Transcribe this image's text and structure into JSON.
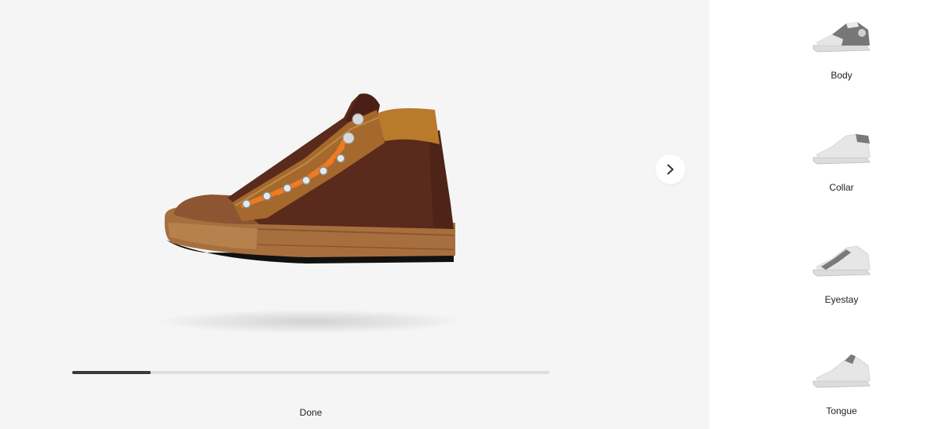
{
  "product": {
    "preview_image": "customized-high-top-sneaker",
    "colors": {
      "upper": "#5a2a1c",
      "collar": "#b97a2c",
      "sole": "#a86f3e",
      "laces": "#f07a22",
      "outsole": "#111111"
    }
  },
  "navigation": {
    "next_icon": "chevron-right-icon"
  },
  "progress": {
    "value": 0.165
  },
  "actions": {
    "done_label": "Done"
  },
  "parts": [
    {
      "label": "Body",
      "icon": "sneaker-body-thumbnail"
    },
    {
      "label": "Collar",
      "icon": "sneaker-collar-thumbnail"
    },
    {
      "label": "Eyestay",
      "icon": "sneaker-eyestay-thumbnail"
    },
    {
      "label": "Tongue",
      "icon": "sneaker-tongue-thumbnail"
    }
  ]
}
